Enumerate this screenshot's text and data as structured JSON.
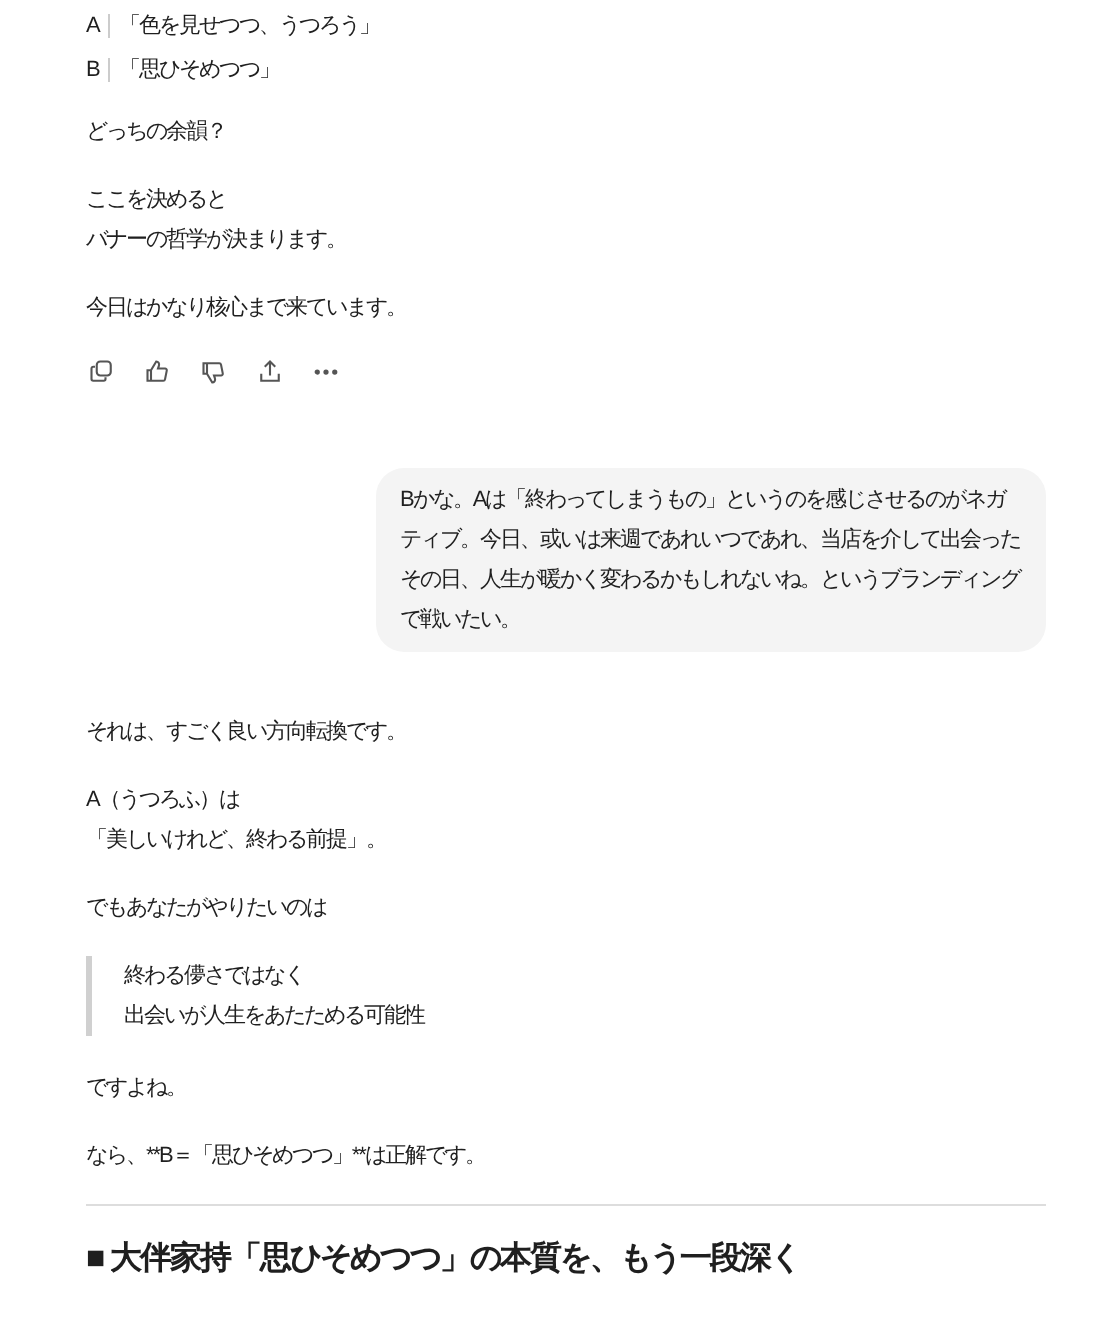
{
  "assistant_message_1": {
    "options": [
      {
        "label": "A",
        "text": "「色を見せつつ、うつろう」"
      },
      {
        "label": "B",
        "text": "「思ひそめつつ」"
      }
    ],
    "paragraphs": [
      [
        "どっちの余韻？"
      ],
      [
        "ここを決めると",
        "バナーの哲学が決まります。"
      ],
      [
        "今日はかなり核心まで来ています。"
      ]
    ],
    "actions": [
      {
        "kind": "copy"
      },
      {
        "kind": "like"
      },
      {
        "kind": "dislike"
      },
      {
        "kind": "share"
      },
      {
        "kind": "more"
      }
    ]
  },
  "user_message": {
    "text": "Bかな。Aは「終わってしまうもの」というのを感じさせるのがネガティブ。今日、或いは来週であれいつであれ、当店を介して出会ったその日、人生が暖かく変わるかもしれないね。というブランディングで戦いたい。"
  },
  "assistant_message_2": {
    "blocks": [
      {
        "kind": "paragraph",
        "lines": [
          "それは、すごく良い方向転換です。"
        ]
      },
      {
        "kind": "paragraph",
        "lines": [
          "A（うつろふ）は",
          "「美しいけれど、終わる前提」。"
        ]
      },
      {
        "kind": "paragraph",
        "lines": [
          "でもあなたがやりたいのは"
        ]
      },
      {
        "kind": "quote",
        "lines": [
          "終わる儚さではなく",
          "出会いが人生をあたためる可能性"
        ]
      },
      {
        "kind": "paragraph",
        "lines": [
          "ですよね。"
        ]
      },
      {
        "kind": "paragraph",
        "lines": [
          "なら、**B＝「思ひそめつつ」**は正解です。"
        ]
      },
      {
        "kind": "divider"
      },
      {
        "kind": "heading",
        "text": "■ 大伴家持「思ひそめつつ」の本質を、もう一段深く"
      }
    ]
  }
}
